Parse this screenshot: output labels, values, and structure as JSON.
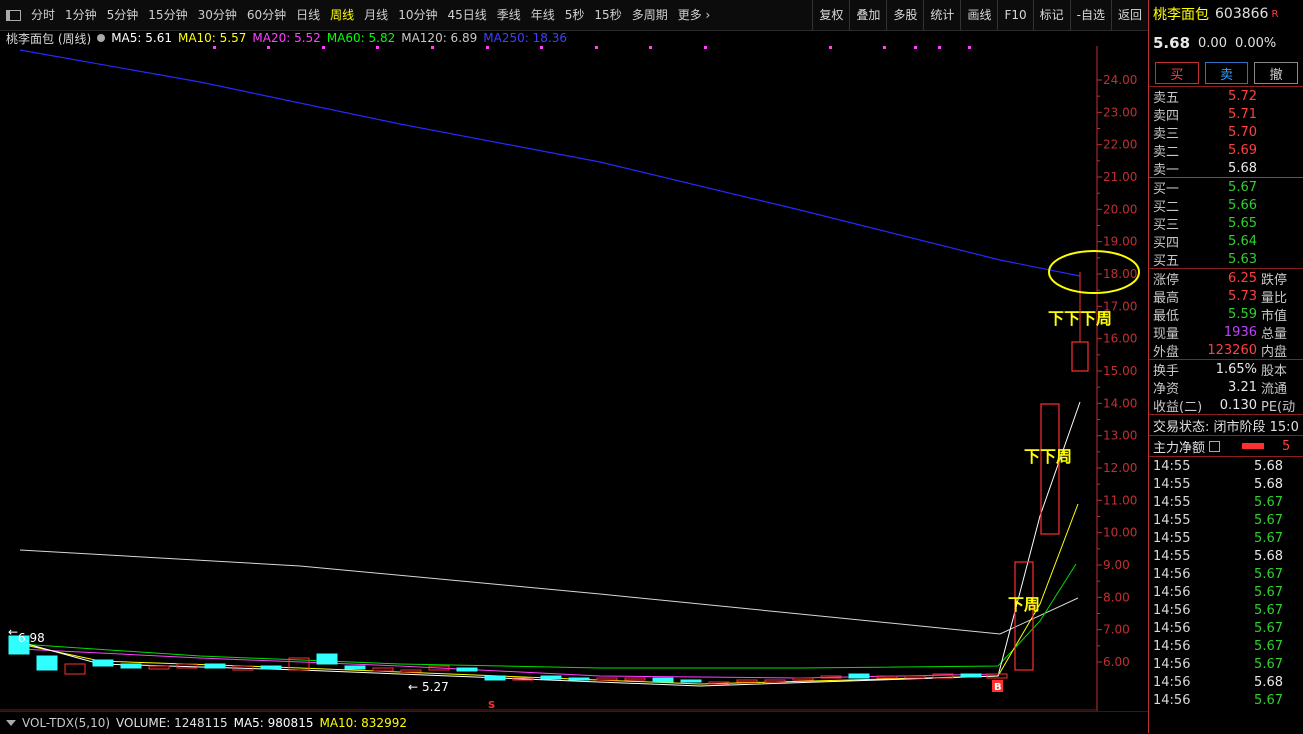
{
  "toolbar": {
    "periods": [
      "分时",
      "1分钟",
      "5分钟",
      "15分钟",
      "30分钟",
      "60分钟",
      "日线",
      "周线",
      "月线",
      "10分钟",
      "45日线",
      "季线",
      "年线",
      "5秒",
      "15秒",
      "多周期",
      "更多 ›"
    ],
    "active_index": 7,
    "right_buttons": [
      "复权",
      "叠加",
      "多股",
      "统计",
      "画线",
      "F10",
      "标记",
      "-自选",
      "返回"
    ]
  },
  "info": {
    "name": "桃李面包 (周线)",
    "ma5": "MA5: 5.61",
    "ma10": "MA10: 5.57",
    "ma20": "MA20: 5.52",
    "ma60": "MA60: 5.82",
    "ma120": "MA120: 6.89",
    "ma250": "MA250: 18.36"
  },
  "colors": {
    "ma5": "#ffffff",
    "ma10": "#ffff00",
    "ma20": "#ff40ff",
    "ma60": "#00ff00",
    "ma120": "#c8c8c8",
    "ma250": "#3030ff",
    "up": "#ff3030",
    "down": "#30ffff",
    "accent": "#ff3030"
  },
  "chart_data": {
    "type": "candlestick",
    "ylim": [
      5.0,
      25.2
    ],
    "yticks": [
      "24.00",
      "23.00",
      "22.00",
      "21.00",
      "20.00",
      "19.00",
      "18.00",
      "17.00",
      "16.00",
      "15.00",
      "14.00",
      "13.00",
      "12.00",
      "11.00",
      "10.00",
      "9.00",
      "8.00",
      "7.00",
      "6.00"
    ],
    "high_label": "6.98",
    "low_label": "5.27",
    "annotations": [
      "下下下周",
      "下下周",
      "下周"
    ],
    "buy_marker": "B",
    "sell_marker": "S"
  },
  "volume": {
    "label": "VOL-TDX(5,10)",
    "volume": "VOLUME: 1248115",
    "ma5": "MA5: 980815",
    "ma10": "MA10: 832992"
  },
  "panel": {
    "name": "桃李面包",
    "code": "603866",
    "badge": "R",
    "price": "5.68",
    "change": "0.00",
    "pct": "0.00%",
    "buy_btn": "买",
    "sell_btn": "卖",
    "cancel_btn": "撤",
    "asks": [
      {
        "label": "卖五",
        "price": "5.72"
      },
      {
        "label": "卖四",
        "price": "5.71"
      },
      {
        "label": "卖三",
        "price": "5.70"
      },
      {
        "label": "卖二",
        "price": "5.69"
      },
      {
        "label": "卖一",
        "price": "5.68"
      }
    ],
    "bids": [
      {
        "label": "买一",
        "price": "5.67"
      },
      {
        "label": "买二",
        "price": "5.66"
      },
      {
        "label": "买三",
        "price": "5.65"
      },
      {
        "label": "买四",
        "price": "5.64"
      },
      {
        "label": "买五",
        "price": "5.63"
      }
    ],
    "stats1": [
      {
        "l": "涨停",
        "v": "6.25",
        "r": "跌停",
        "c": "red"
      },
      {
        "l": "最高",
        "v": "5.73",
        "r": "量比",
        "c": "red"
      },
      {
        "l": "最低",
        "v": "5.59",
        "r": "市值",
        "c": "green"
      },
      {
        "l": "现量",
        "v": "1936",
        "r": "总量",
        "c": "purple"
      },
      {
        "l": "外盘",
        "v": "123260",
        "r": "内盘",
        "c": "red"
      }
    ],
    "stats2": [
      {
        "l": "换手",
        "v": "1.65%",
        "r": "股本"
      },
      {
        "l": "净资",
        "v": "3.21",
        "r": "流通"
      },
      {
        "l": "收益(二)",
        "v": "0.130",
        "r": "PE(动"
      }
    ],
    "trade_state": "交易状态: 闭市阶段 15:0",
    "main_flow": "主力净额",
    "main_flow_val": "5",
    "ticks": [
      {
        "t": "14:55",
        "p": "5.68",
        "c": "white"
      },
      {
        "t": "14:55",
        "p": "5.68",
        "c": "white"
      },
      {
        "t": "14:55",
        "p": "5.67",
        "c": "green"
      },
      {
        "t": "14:55",
        "p": "5.67",
        "c": "green"
      },
      {
        "t": "14:55",
        "p": "5.67",
        "c": "green"
      },
      {
        "t": "14:55",
        "p": "5.68",
        "c": "white"
      },
      {
        "t": "14:56",
        "p": "5.67",
        "c": "green"
      },
      {
        "t": "14:56",
        "p": "5.67",
        "c": "green"
      },
      {
        "t": "14:56",
        "p": "5.67",
        "c": "green"
      },
      {
        "t": "14:56",
        "p": "5.67",
        "c": "green"
      },
      {
        "t": "14:56",
        "p": "5.67",
        "c": "green"
      },
      {
        "t": "14:56",
        "p": "5.67",
        "c": "green"
      },
      {
        "t": "14:56",
        "p": "5.68",
        "c": "white"
      },
      {
        "t": "14:56",
        "p": "5.67",
        "c": "green"
      }
    ]
  }
}
